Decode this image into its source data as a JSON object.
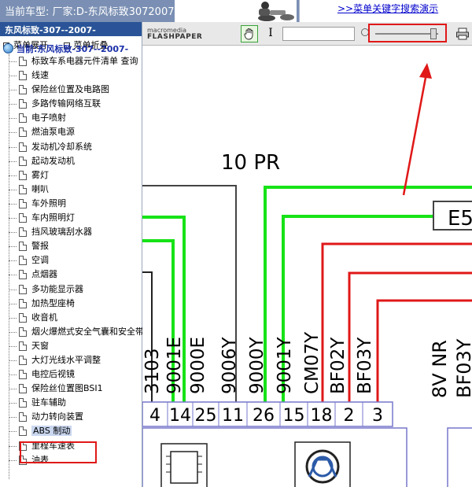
{
  "header": {
    "car_title": "当前车型:  厂家:D-东风标致3072007-",
    "search_demo_link": ">>菜单关键字搜索演示"
  },
  "sidebar": {
    "title": "东风标致-307--2007-",
    "expand_label": "菜单展开",
    "collapse_label": "菜单折叠",
    "current_label": "当前:东风标致-307--2007-",
    "items": [
      {
        "label": "标致车系电器元件清单 查询"
      },
      {
        "label": "线速"
      },
      {
        "label": "保险丝位置及电路图"
      },
      {
        "label": "多路传输网络互联"
      },
      {
        "label": "电子喷射"
      },
      {
        "label": "燃油泵电源"
      },
      {
        "label": "发动机冷却系统"
      },
      {
        "label": "起动发动机"
      },
      {
        "label": "雾灯"
      },
      {
        "label": "喇叭"
      },
      {
        "label": "车外照明"
      },
      {
        "label": "车内照明灯"
      },
      {
        "label": "挡风玻璃刮水器"
      },
      {
        "label": "警报"
      },
      {
        "label": "空调"
      },
      {
        "label": "点烟器"
      },
      {
        "label": "多功能显示器"
      },
      {
        "label": "加热型座椅"
      },
      {
        "label": "收音机"
      },
      {
        "label": "烟火爆燃式安全气囊和安全带"
      },
      {
        "label": "天窗"
      },
      {
        "label": "大灯光线水平调整"
      },
      {
        "label": "电控后视镜"
      },
      {
        "label": "保险丝位置图BSI1"
      },
      {
        "label": "驻车辅助"
      },
      {
        "label": "动力转向装置"
      },
      {
        "label": "ABS 制动",
        "selected": true
      },
      {
        "label": "里程车速表"
      },
      {
        "label": "油表"
      }
    ]
  },
  "viewer": {
    "brand_line1": "macromedia",
    "brand_line2": "FLASHPAPER",
    "zoom_level": 0.92
  },
  "diagram": {
    "connector_label": "10 PR",
    "right_box_label": "E5",
    "right_vertical_label": "8V NR",
    "wire_labels": [
      "3103",
      "9001E",
      "9000E",
      "9006Y",
      "9000Y",
      "9001Y",
      "CM07Y",
      "BF02Y",
      "BF03Y"
    ],
    "pin_numbers": [
      "4",
      "14",
      "25",
      "11",
      "26",
      "15",
      "18",
      "2",
      "3"
    ],
    "right_wire_label": "BF03Y",
    "colors": {
      "green": "#17e317",
      "red": "#e01818",
      "connector_blue": "#7777cc",
      "annotation_red": "#e01818"
    }
  }
}
